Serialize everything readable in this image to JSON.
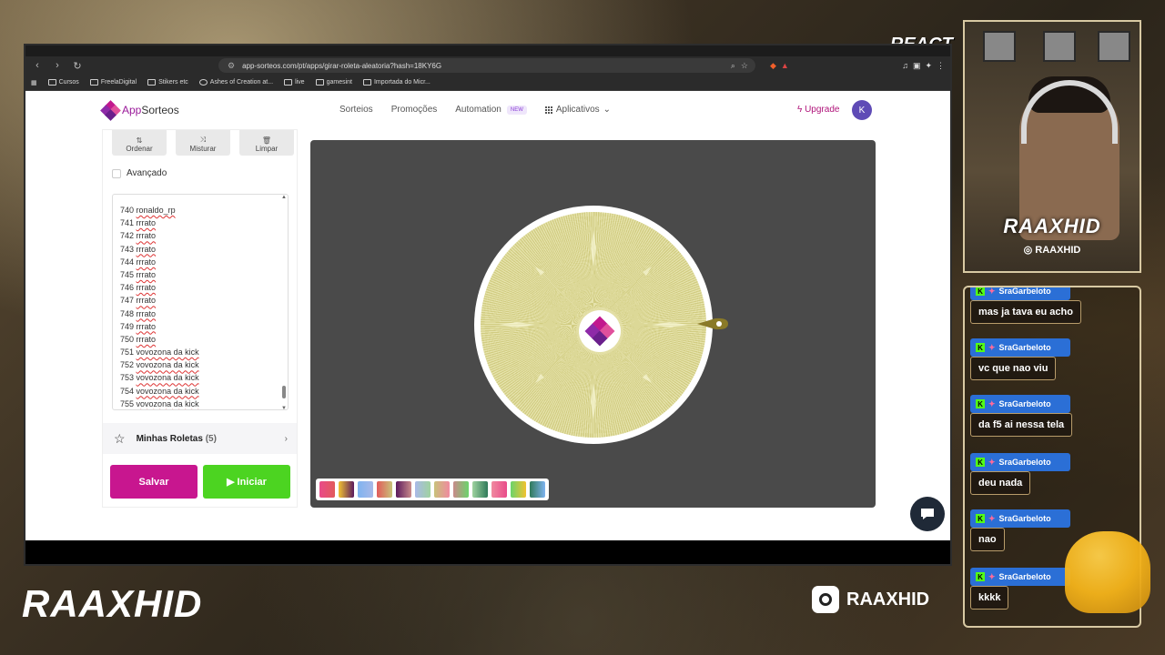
{
  "overlay": {
    "react_label": "REACT",
    "cam_brand": "RAAXHID",
    "cam_instagram": "RAAXHID",
    "footer_brand": "RAAXHID",
    "footer_instagram": "RAAXHID"
  },
  "browser": {
    "url": "app-sorteos.com/pt/apps/girar-roleta-aleatoria?hash=18KY6G",
    "bookmarks": [
      "Cursos",
      "FreelaDigital",
      "Stikers etc",
      "Ashes of Creation at...",
      "live",
      "gamesint",
      "Importada do Micr..."
    ]
  },
  "site": {
    "logo_app": "App",
    "logo_sorteos": "Sorteos",
    "nav": {
      "sorteios": "Sorteios",
      "promocoes": "Promoções",
      "automation": "Automation",
      "new_tag": "NEW",
      "aplicativos": "Aplicativos"
    },
    "upgrade": "Upgrade",
    "avatar_letter": "K"
  },
  "panel": {
    "tools": {
      "ordenar": "Ordenar",
      "misturar": "Misturar",
      "limpar": "Limpar"
    },
    "avancado": "Avançado",
    "entries": [
      {
        "num": "740",
        "name": "ronaldo_rp"
      },
      {
        "num": "741",
        "name": "rrrato"
      },
      {
        "num": "742",
        "name": " rrrato"
      },
      {
        "num": "743",
        "name": "rrrato"
      },
      {
        "num": "744",
        "name": " rrrato"
      },
      {
        "num": "745",
        "name": "rrrato"
      },
      {
        "num": "746",
        "name": "rrrato"
      },
      {
        "num": "747",
        "name": "rrrato"
      },
      {
        "num": "748",
        "name": " rrrato"
      },
      {
        "num": "749",
        "name": "rrrato"
      },
      {
        "num": "750",
        "name": " rrrato"
      },
      {
        "num": "751",
        "name": "vovozona da kick"
      },
      {
        "num": "752",
        "name": "vovozona da kick"
      },
      {
        "num": "753",
        "name": "vovozona da kick"
      },
      {
        "num": "754",
        "name": "vovozona da kick"
      },
      {
        "num": "755",
        "name": "vovozona da kick"
      }
    ],
    "minhas_roletas": "Minhas Roletas",
    "minhas_count": "(5)",
    "salvar": "Salvar",
    "iniciar": "Iniciar"
  },
  "palette_colors": [
    "#e94b8a",
    "#f2c230",
    "#7fb3f0",
    "#e25b5b",
    "#5b1a5e",
    "#a9b9e8",
    "#c8c27a",
    "#c98a8a",
    "#9fd39f",
    "#f08aa0",
    "#6bd46b",
    "#2f7a5a"
  ],
  "chat": [
    {
      "user": "SraGarbeloto",
      "text": "mas ja tava eu acho"
    },
    {
      "user": "SraGarbeloto",
      "text": "vc que nao viu"
    },
    {
      "user": "SraGarbeloto",
      "text": "da f5 ai nessa tela"
    },
    {
      "user": "SraGarbeloto",
      "text": "deu nada"
    },
    {
      "user": "SraGarbeloto",
      "text": "nao"
    },
    {
      "user": "SraGarbeloto",
      "text": "kkkk"
    }
  ]
}
